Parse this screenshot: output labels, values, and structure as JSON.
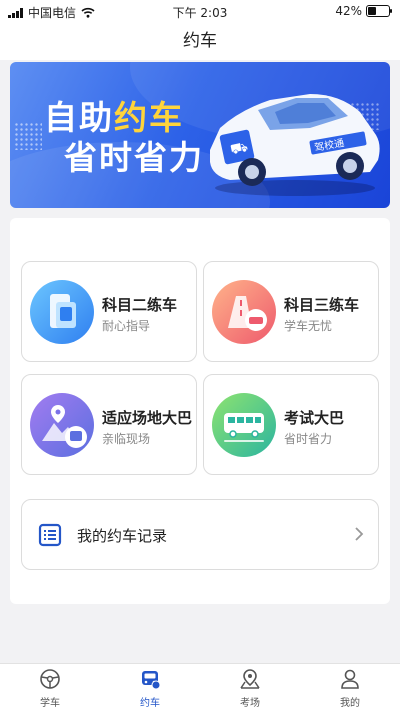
{
  "status": {
    "carrier": "中国电信",
    "time": "下午 2:03",
    "battery": "42%",
    "battery_level": 0.42
  },
  "nav": {
    "title": "约车"
  },
  "banner": {
    "line1_a": "自助",
    "line1_b": "约车",
    "line2": "省时省力",
    "brand": "驾校通",
    "colors": {
      "bg": "#2d62e8",
      "highlight": "#ffd43b"
    }
  },
  "services": [
    {
      "title": "科目二练车",
      "subtitle": "耐心指导",
      "icon": "phone-car-icon"
    },
    {
      "title": "科目三练车",
      "subtitle": "学车无忧",
      "icon": "road-car-icon"
    },
    {
      "title": "适应场地大巴",
      "subtitle": "亲临现场",
      "icon": "map-bus-icon"
    },
    {
      "title": "考试大巴",
      "subtitle": "省时省力",
      "icon": "bus-icon"
    }
  ],
  "records": {
    "label": "我的约车记录"
  },
  "tabs": [
    {
      "label": "学车",
      "icon": "steering-wheel-icon",
      "active": false
    },
    {
      "label": "约车",
      "icon": "car-booking-icon",
      "active": true
    },
    {
      "label": "考场",
      "icon": "location-pin-icon",
      "active": false
    },
    {
      "label": "我的",
      "icon": "user-icon",
      "active": false
    }
  ],
  "accent": "#2456c8"
}
